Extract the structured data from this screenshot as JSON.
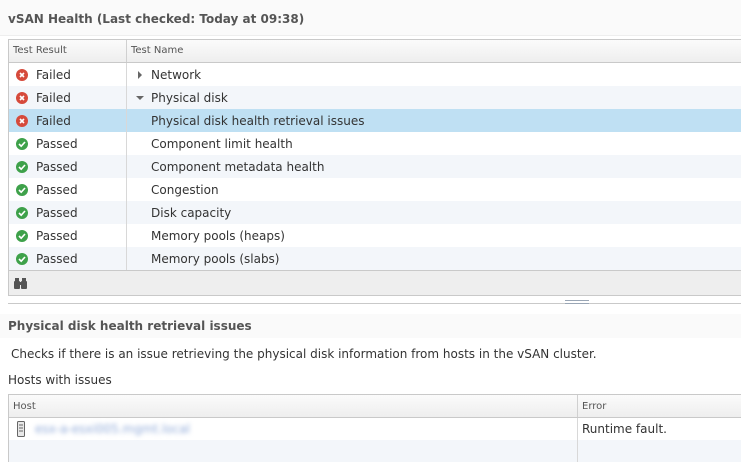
{
  "header": {
    "title": "vSAN Health (Last checked: Today at 09:38)"
  },
  "grid": {
    "columns": {
      "result": "Test Result",
      "name": "Test Name"
    },
    "rows": [
      {
        "result": "Failed",
        "name": "Network",
        "status": "failed",
        "expander": "collapsed"
      },
      {
        "result": "Failed",
        "name": "Physical disk",
        "status": "failed",
        "expander": "expanded"
      },
      {
        "result": "Failed",
        "name": "Physical disk health retrieval issues",
        "status": "failed",
        "selected": true
      },
      {
        "result": "Passed",
        "name": "Component limit health",
        "status": "passed"
      },
      {
        "result": "Passed",
        "name": "Component metadata health",
        "status": "passed"
      },
      {
        "result": "Passed",
        "name": "Congestion",
        "status": "passed"
      },
      {
        "result": "Passed",
        "name": "Disk capacity",
        "status": "passed"
      },
      {
        "result": "Passed",
        "name": "Memory pools (heaps)",
        "status": "passed"
      },
      {
        "result": "Passed",
        "name": "Memory pools (slabs)",
        "status": "passed"
      }
    ],
    "footer_icon": "binoculars-icon"
  },
  "detail": {
    "title": "Physical disk health retrieval issues",
    "description": "Checks if there is an issue retrieving the physical disk information from hosts in the vSAN cluster.",
    "hosts_label": "Hosts with issues",
    "columns": {
      "host": "Host",
      "error": "Error"
    },
    "hosts": [
      {
        "host": "esx-a-esxi005.mgmt.local",
        "error": "Runtime fault."
      }
    ]
  },
  "colors": {
    "selected_row": "#bfe0f3",
    "failed": "#d64a3b",
    "passed": "#3ea14a",
    "alt_row": "#f3f6fa"
  }
}
